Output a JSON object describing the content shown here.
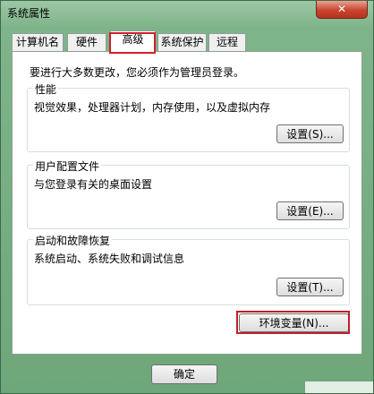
{
  "window": {
    "title": "系统属性",
    "close_label": "✕"
  },
  "tabs": [
    {
      "label": "计算机名"
    },
    {
      "label": "硬件"
    },
    {
      "label": "高级"
    },
    {
      "label": "系统保护"
    },
    {
      "label": "远程"
    }
  ],
  "advanced": {
    "notice": "要进行大多数更改，您必须作为管理员登录。",
    "performance": {
      "title": "性能",
      "desc": "视觉效果，处理器计划，内存使用，以及虚拟内存",
      "button": "设置(S)..."
    },
    "user_profiles": {
      "title": "用户配置文件",
      "desc": "与您登录有关的桌面设置",
      "button": "设置(E)..."
    },
    "startup_recovery": {
      "title": "启动和故障恢复",
      "desc": "系统启动、系统失败和调试信息",
      "button": "设置(T)..."
    },
    "env_button": "环境变量(N)..."
  },
  "footer": {
    "ok_button": "确定"
  }
}
